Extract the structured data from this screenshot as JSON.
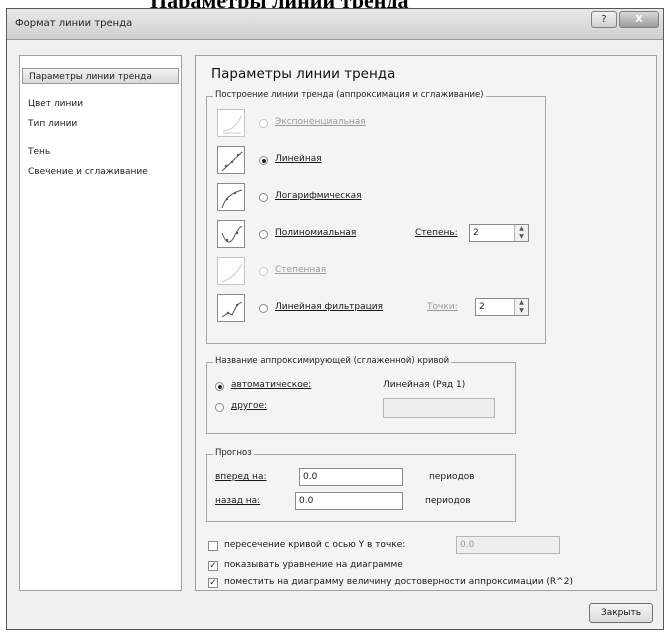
{
  "caption": "Параметры линии тренда",
  "window": {
    "title": "Формат линии тренда",
    "help_glyph": "?",
    "close_glyph": "X"
  },
  "nav": {
    "items": [
      {
        "label": "Параметры линии тренда",
        "selected": true
      },
      {
        "label": "Цвет линии"
      },
      {
        "label": "Тип линии"
      },
      {
        "label": "Тень"
      },
      {
        "label": "Свечение и сглаживание"
      }
    ]
  },
  "panel": {
    "heading": "Параметры линии тренда",
    "trend_group": {
      "legend": "Построение линии тренда (аппроксимация и сглаживание)",
      "options": [
        {
          "label": "Экспоненциальная",
          "selected": false,
          "enabled": false,
          "icon": "exponential-chart-icon"
        },
        {
          "label": "Линейная",
          "selected": true,
          "enabled": true,
          "icon": "linear-chart-icon"
        },
        {
          "label": "Логарифмическая",
          "selected": false,
          "enabled": true,
          "icon": "logarithmic-chart-icon"
        },
        {
          "label": "Полиномиальная",
          "selected": false,
          "enabled": true,
          "icon": "polynomial-chart-icon"
        },
        {
          "label": "Степенная",
          "selected": false,
          "enabled": false,
          "icon": "power-chart-icon"
        },
        {
          "label": "Линейная фильтрация",
          "selected": false,
          "enabled": true,
          "icon": "moving-average-chart-icon"
        }
      ],
      "degree_label": "Степень:",
      "degree_value": "2",
      "points_label": "Точки:",
      "points_value": "2"
    },
    "name_group": {
      "legend": "Название аппроксимирующей (сглаженной) кривой",
      "auto_label": "автоматическое:",
      "auto_value": "Линейная (Ряд 1)",
      "auto_selected": true,
      "other_label": "другое:",
      "other_value": ""
    },
    "forecast_group": {
      "legend": "Прогноз",
      "forward_label": "вперед на:",
      "forward_value": "0.0",
      "forward_unit": "периодов",
      "backward_label": "назад на:",
      "backward_value": "0.0",
      "backward_unit": "периодов"
    },
    "checks": {
      "intercept_label": "пересечение кривой с осью Y в точке:",
      "intercept_checked": false,
      "intercept_value": "0.0",
      "equation_label": "показывать уравнение на диаграмме",
      "equation_checked": true,
      "r2_label": "поместить на диаграмму величину достоверности аппроксимации (R^2)",
      "r2_checked": true,
      "check_glyph": "✓"
    }
  },
  "footer": {
    "close_button": "Закрыть"
  }
}
